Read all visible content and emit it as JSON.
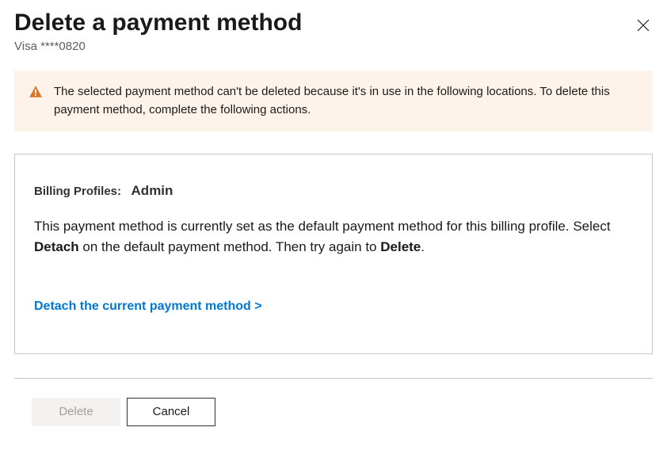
{
  "header": {
    "title": "Delete a payment method",
    "subtitle": "Visa ****0820"
  },
  "warning": {
    "text": "The selected payment method can't be deleted because it's in use in the following locations. To delete this payment method, complete the following actions."
  },
  "card": {
    "profile_label": "Billing Profiles:",
    "profile_name": "Admin",
    "desc_before": "This payment method is currently set as the default payment method for this billing profile. Select ",
    "desc_bold1": "Detach",
    "desc_mid": " on the default payment method. Then try again to ",
    "desc_bold2": "Delete",
    "desc_after": ".",
    "detach_link": "Detach the current payment method >"
  },
  "footer": {
    "delete_label": "Delete",
    "cancel_label": "Cancel"
  }
}
